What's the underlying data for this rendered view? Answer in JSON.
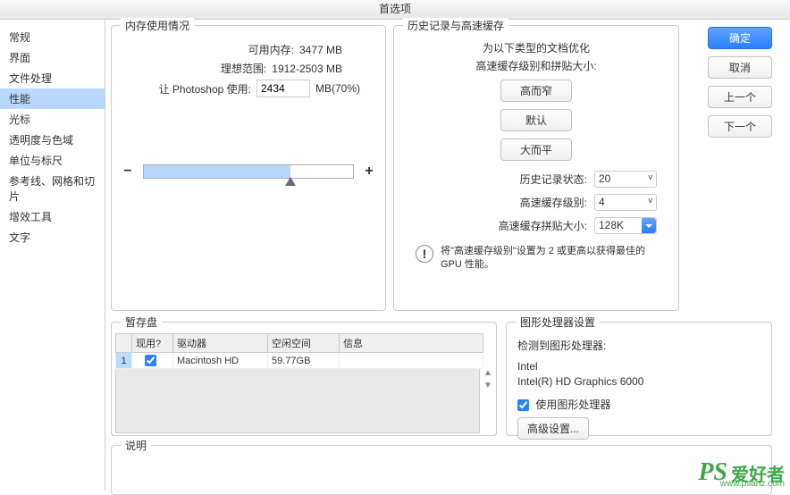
{
  "window": {
    "title": "首选项"
  },
  "sidebar": {
    "items": [
      {
        "label": "常规"
      },
      {
        "label": "界面"
      },
      {
        "label": "文件处理"
      },
      {
        "label": "性能",
        "selected": true
      },
      {
        "label": "光标"
      },
      {
        "label": "透明度与色域"
      },
      {
        "label": "单位与标尺"
      },
      {
        "label": "参考线、网格和切片"
      },
      {
        "label": "增效工具"
      },
      {
        "label": "文字"
      }
    ]
  },
  "buttons": {
    "ok": "确定",
    "cancel": "取消",
    "prev": "上一个",
    "next": "下一个"
  },
  "memory": {
    "title": "内存使用情况",
    "avail_label": "可用内存:",
    "avail_value": "3477 MB",
    "ideal_label": "理想范围:",
    "ideal_value": "1912-2503 MB",
    "let_label": "让 Photoshop 使用:",
    "let_value": "2434",
    "let_suffix": "MB(70%)",
    "slider_percent": 70,
    "minus": "−",
    "plus": "+"
  },
  "history": {
    "title": "历史记录与高速缓存",
    "l1": "为以下类型的文档优化",
    "l2": "高速缓存级别和拼贴大小:",
    "btn_tall": "高而窄",
    "btn_default": "默认",
    "btn_big": "大而平",
    "states_label": "历史记录状态:",
    "states_value": "20",
    "levels_label": "高速缓存级别:",
    "levels_value": "4",
    "tile_label": "高速缓存拼贴大小:",
    "tile_value": "128K",
    "note": "将\"高速缓存级别\"设置为 2 或更高以获得最佳的 GPU 性能。",
    "warn": "!"
  },
  "scratch": {
    "title": "暂存盘",
    "cols": {
      "c0": "",
      "c1": "现用?",
      "c2": "驱动器",
      "c3": "空闲空间",
      "c4": "信息"
    },
    "row": {
      "n": "1",
      "active": true,
      "drive": "Macintosh HD",
      "free": "59.77GB",
      "info": ""
    }
  },
  "gpu": {
    "title": "图形处理器设置",
    "detected_label": "检测到图形处理器:",
    "vendor": "Intel",
    "model": "Intel(R) HD Graphics 6000",
    "use_label": "使用图形处理器",
    "use_checked": true,
    "adv_btn": "高级设置..."
  },
  "desc": {
    "title": "说明"
  },
  "watermark": {
    "big": "PS",
    "ch": "爱好者",
    "url": "www.psahz.com"
  }
}
